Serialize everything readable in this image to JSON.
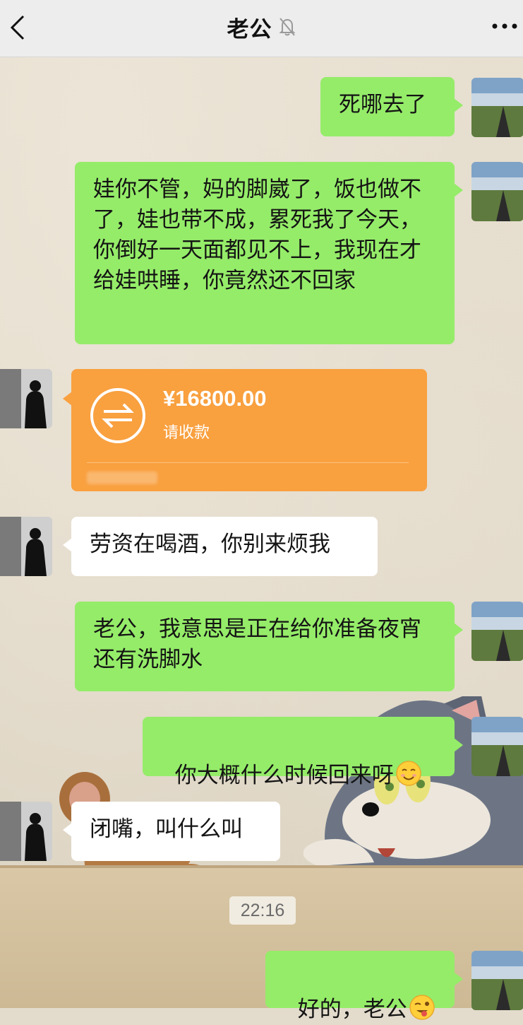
{
  "header": {
    "title": "老公",
    "mute_icon": "bell-off-icon",
    "back_icon": "chevron-left-icon",
    "more_icon": "ellipsis-icon"
  },
  "messages": [
    {
      "from": "me",
      "text": "死哪去了"
    },
    {
      "from": "me",
      "text": "娃你不管，妈的脚崴了，饭也做不了，娃也带不成，累死我了今天，你倒好一天面都见不上，我现在才给娃哄睡，你竟然还不回家"
    },
    {
      "from": "him",
      "type": "transfer",
      "amount": "¥16800.00",
      "label": "请收款"
    },
    {
      "from": "him",
      "text": "劳资在喝酒，你别来烦我"
    },
    {
      "from": "me",
      "text": "老公，我意思是正在给你准备夜宵还有洗脚水"
    },
    {
      "from": "me",
      "text": "你大概什么时候回来呀",
      "emoji": "smiling-face-icon"
    },
    {
      "from": "him",
      "text": "闭嘴，叫什么叫"
    },
    {
      "from": "me",
      "text": "好的，老公",
      "emoji": "winking-tongue-face-icon"
    }
  ],
  "timestamp": "22:16",
  "colors": {
    "my_bubble": "#95ec69",
    "their_bubble": "#ffffff",
    "transfer": "#f9a03f",
    "header_bg": "#ededed"
  }
}
